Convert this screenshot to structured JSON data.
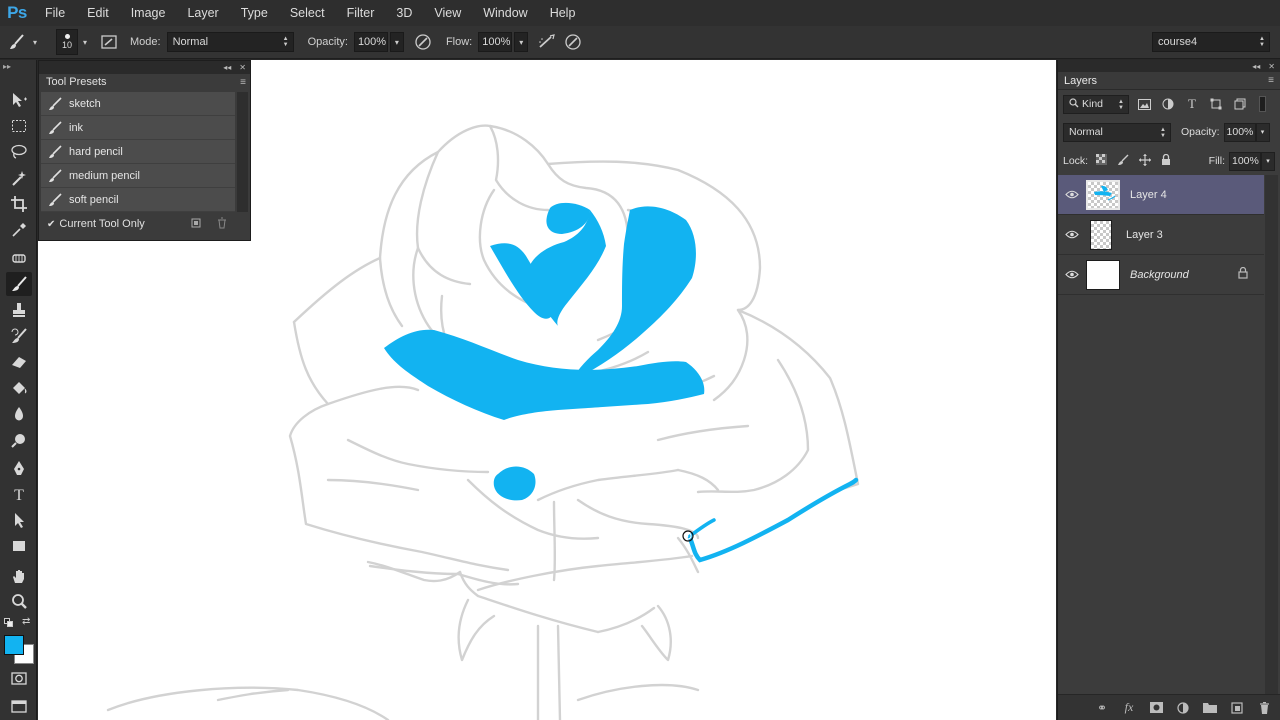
{
  "app": {
    "logo": "Ps"
  },
  "menu": [
    "File",
    "Edit",
    "Image",
    "Layer",
    "Type",
    "Select",
    "Filter",
    "3D",
    "View",
    "Window",
    "Help"
  ],
  "options": {
    "brush_size": "10",
    "mode_label": "Mode:",
    "mode_value": "Normal",
    "opacity_label": "Opacity:",
    "opacity_value": "100%",
    "flow_label": "Flow:",
    "flow_value": "100%",
    "workspace": "course4"
  },
  "tool_presets": {
    "title": "Tool Presets",
    "items": [
      "sketch",
      "ink",
      "hard pencil",
      "medium pencil",
      "soft pencil"
    ],
    "current_tool_only": "Current Tool Only"
  },
  "colors": {
    "foreground": "#12b3f1",
    "background": "#ffffff",
    "accent": "#12b3f1",
    "sketch_line": "#d2d2d2"
  },
  "layers_panel": {
    "tab": "Layers",
    "filter_kind": "Kind",
    "blend_mode": "Normal",
    "opacity_label": "Opacity:",
    "opacity_value": "100%",
    "lock_label": "Lock:",
    "fill_label": "Fill:",
    "fill_value": "100%",
    "layers": [
      {
        "name": "Layer 4",
        "selected": true,
        "visible": true
      },
      {
        "name": "Layer 3",
        "selected": false,
        "visible": true
      },
      {
        "name": "Background",
        "selected": false,
        "visible": true,
        "locked": true
      }
    ]
  }
}
